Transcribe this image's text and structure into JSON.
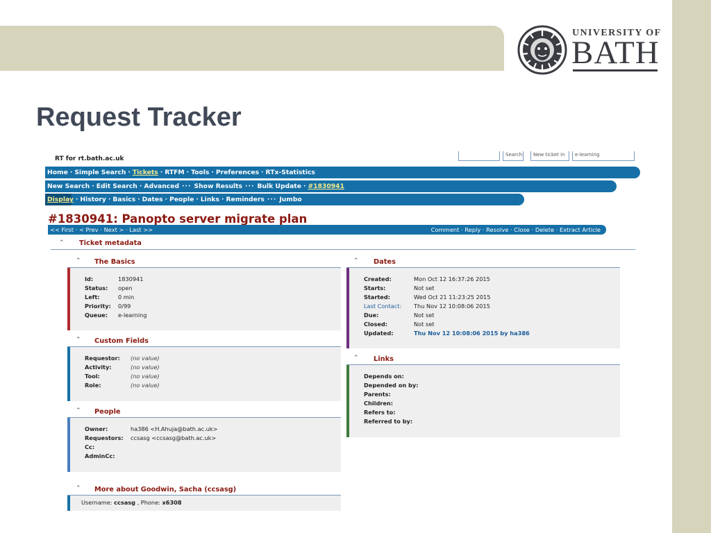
{
  "slide": {
    "title": "Request Tracker",
    "logo": {
      "line1": "UNIVERSITY OF",
      "line2": "BATH"
    }
  },
  "rt": {
    "host": "RT for rt.bath.ac.uk",
    "top_inputs": {
      "search_value": "",
      "search_btn": "Search",
      "new_ticket_btn": "New ticket in",
      "queue_select": "e-learning"
    },
    "nav_main": [
      "Home",
      "Simple Search",
      "Tickets",
      "RTFM",
      "Tools",
      "Preferences",
      "RTx-Statistics"
    ],
    "nav_tickets": [
      "New Search",
      "Edit Search",
      "Advanced",
      "Show Results",
      "Bulk Update",
      "#1830941"
    ],
    "nav_ticket": [
      "Display",
      "History",
      "Basics",
      "Dates",
      "People",
      "Links",
      "Reminders",
      "Jumbo"
    ],
    "ticket_title": "#1830941: Panopto server migrate plan",
    "pager": {
      "first": "<< First",
      "prev": "< Prev",
      "next": "Next >",
      "last": "Last >>"
    },
    "actions": [
      "Comment",
      "Reply",
      "Resolve",
      "Close",
      "Delete",
      "Extract Article"
    ],
    "metadata_header": "Ticket metadata",
    "basics": {
      "header": "The Basics",
      "rows": [
        {
          "k": "Id:",
          "v": "1830941"
        },
        {
          "k": "Status:",
          "v": "open"
        },
        {
          "k": "Left:",
          "v": "0 min"
        },
        {
          "k": "Priority:",
          "v": "0/99"
        },
        {
          "k": "Queue:",
          "v": "e-learning"
        }
      ]
    },
    "custom": {
      "header": "Custom Fields",
      "rows": [
        {
          "k": "Requestor:",
          "v": "(no value)"
        },
        {
          "k": "Activity:",
          "v": "(no value)"
        },
        {
          "k": "Tool:",
          "v": "(no value)"
        },
        {
          "k": "Role:",
          "v": "(no value)"
        }
      ]
    },
    "people": {
      "header": "People",
      "rows": [
        {
          "k": "Owner:",
          "v": "ha386 <H.Ahuja@bath.ac.uk>"
        },
        {
          "k": "Requestors:",
          "v": "ccsasg <ccsasg@bath.ac.uk>"
        },
        {
          "k": "Cc:",
          "v": ""
        },
        {
          "k": "AdminCc:",
          "v": ""
        }
      ]
    },
    "more": {
      "header": "More about Goodwin, Sacha (ccsasg)",
      "username_label": "Username:",
      "username": "ccsasg",
      "phone_label": ", Phone:",
      "phone": "x6308"
    },
    "dates": {
      "header": "Dates",
      "rows": [
        {
          "k": "Created:",
          "v": "Mon Oct 12 16:37:26 2015"
        },
        {
          "k": "Starts:",
          "v": "Not set"
        },
        {
          "k": "Started:",
          "v": "Wed Oct 21 11:23:25 2015"
        },
        {
          "k": "Last Contact:",
          "v": "Thu Nov 12 10:08:06 2015"
        },
        {
          "k": "Due:",
          "v": "Not set"
        },
        {
          "k": "Closed:",
          "v": "Not set"
        },
        {
          "k": "Updated:",
          "v": "Thu Nov 12 10:08:06 2015 by ha386"
        }
      ]
    },
    "links": {
      "header": "Links",
      "rows": [
        {
          "k": "Depends on:"
        },
        {
          "k": "Depended on by:"
        },
        {
          "k": "Parents:"
        },
        {
          "k": "Children:"
        },
        {
          "k": "Refers to:"
        },
        {
          "k": "Referred to by:"
        }
      ]
    },
    "colors": {
      "nav_blue": "#1670a7",
      "header_red": "#8a1a12",
      "basics_bar": "#b2292e",
      "dates_bar": "#6e2f7f",
      "links_bar": "#3f7a3a",
      "custom_bar": "#1670a7",
      "people_bar": "#4a7fbf"
    }
  }
}
